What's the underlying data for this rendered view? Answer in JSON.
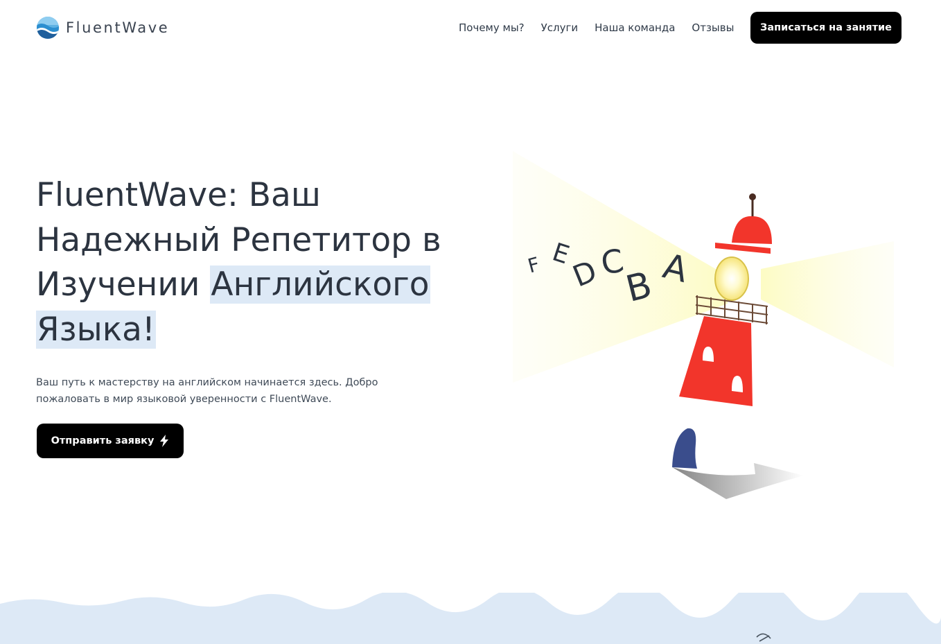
{
  "brand": {
    "name": "FluentWave",
    "logo_icon": "wave-globe-icon",
    "accent_color": "#000000",
    "highlight_color": "#dde9f6",
    "wave_color": "#dde9f6"
  },
  "nav": {
    "items": [
      {
        "label": "Почему мы?"
      },
      {
        "label": "Услуги"
      },
      {
        "label": "Наша команда"
      },
      {
        "label": "Отзывы"
      }
    ],
    "cta_label": "Записаться на занятие"
  },
  "hero": {
    "title_plain": "FluentWave: Ваш Надежный Репетитор в Изучении ",
    "title_highlight_1": "Английского",
    "title_highlight_2": "Языка!",
    "subtitle": "Ваш путь к мастерству на английском начинается здесь. Добро пожаловать в мир языковой уверенности с FluentWave.",
    "cta_label": "Отправить заявку",
    "cta_icon": "lightning-bolt-icon"
  },
  "illustration": {
    "subject": "lighthouse-icon",
    "letters": [
      "F",
      "E",
      "D",
      "C",
      "B",
      "A"
    ]
  }
}
